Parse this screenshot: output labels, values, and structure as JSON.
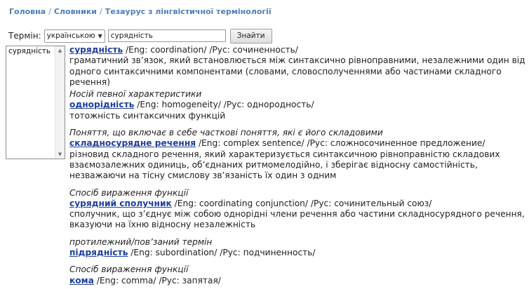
{
  "breadcrumb": {
    "home": "Головна",
    "dictionaries": "Словники",
    "current": "Тезаурус з лінгвістичної термінології",
    "separator": "/"
  },
  "search": {
    "label": "Термін:",
    "language": "українською",
    "query": "сурядність",
    "button": "Знайти"
  },
  "results_list": [
    "сурядність"
  ],
  "entry": {
    "term": "сурядність",
    "translations": " /Eng: coordination/ /Рус: сочиненность/",
    "definition": "граматичний зв’язок, який встановлюється між синтаксично рівноправними, незалежними один від одного синтаксичними компонентами (словами, словосполученнями або частинами складного речення)"
  },
  "relations": [
    {
      "note": "Носій певної характеристики",
      "term": "однорідність",
      "translations": " /Eng: homogeneity/ /Рус: однородность/",
      "definition": "тотожність синтаксичних функцій"
    },
    {
      "note": "Поняття, що включає в себе часткові поняття, які є його складовими",
      "term": "складносурядне речення",
      "translations": " /Eng: complex sentence/ /Рус: сложносочиненное предложение/",
      "definition": "різновид складного речення, який характеризується синтаксичною рівноправністю складових взаємозалежних одиниць, об’єднаних ритмомелодійно, і зберігає відносну самостійність, незважаючи на тісну смислову зв’язаність їх один з одним"
    },
    {
      "note": "Спосіб вираження функції",
      "term": "сурядний сполучник",
      "translations": " /Eng: coordinating conjunction/ /Рус: сочинительный союз/",
      "definition": "сполучник, що з’єднує між собою однорідні члени речення або частини складносурядного речення, вказуючи на їхню відносну незалежність"
    },
    {
      "note": "протилежний/пов’заний термін",
      "term": "підрядність",
      "translations": " /Eng: subordination/ /Рус: подчиненность/",
      "definition": ""
    },
    {
      "note": "Спосіб вираження функції",
      "term": "кома",
      "translations": " /Eng: comma/ /Рус: запятая/",
      "definition": ""
    }
  ]
}
